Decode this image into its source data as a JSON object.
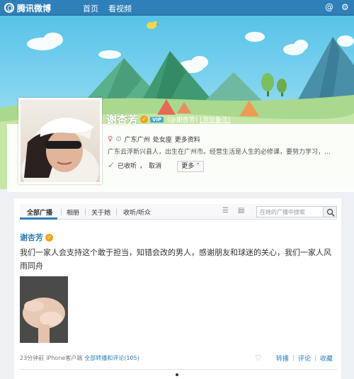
{
  "app": {
    "brand": "腾讯微博"
  },
  "nav": {
    "home": "首页",
    "video": "看视频"
  },
  "profile": {
    "name": "谢杏芳",
    "vip": "VIP",
    "handle": "(@谢杏芳)",
    "add_remark": "[添加备注]",
    "location": "广东广州",
    "zodiac": "处女座",
    "more_info": "更多资料",
    "bio": "广东云浮新兴县人，出生在广州市。经营生活是人生的必修课，要努力学习，…",
    "follow_status": "已收听",
    "cancel": "取消",
    "more_button": "更多"
  },
  "tabs": [
    {
      "label": "全部广播"
    },
    {
      "label": "相册"
    },
    {
      "label": "关于她"
    },
    {
      "label": "收听/听众"
    }
  ],
  "search": {
    "placeholder": "在她的广播中搜索"
  },
  "post": {
    "author": "谢杏芳",
    "text": "我们一家人会支持这个敢于担当，知错会改的男人，感谢朋友和球迷的关心，我们一家人风雨同舟",
    "time": "23分钟前",
    "source": "iPhone客户端",
    "replies_link": "全部转播和评论(105)",
    "actions": {
      "repost": "转播",
      "comment": "评论",
      "favorite": "收藏"
    }
  }
}
